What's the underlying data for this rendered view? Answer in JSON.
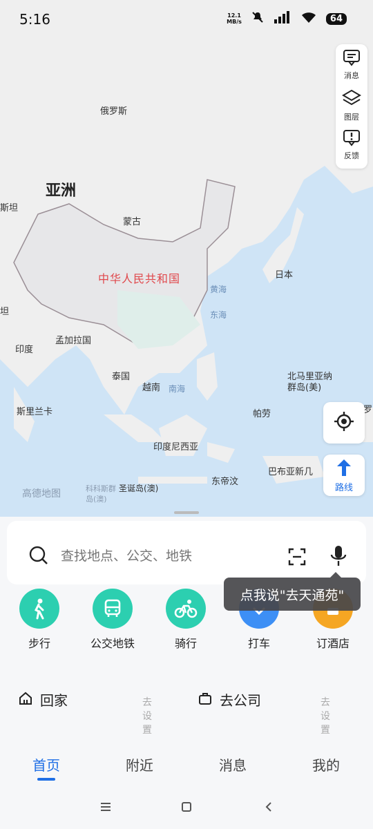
{
  "status_bar": {
    "time": "5:16",
    "net_speed_top": "12.1",
    "net_speed_bottom": "MB/s",
    "battery": "64"
  },
  "map": {
    "labels": {
      "russia": "俄罗斯",
      "asia": "亚洲",
      "mongolia": "蒙古",
      "china": "中华人民共和国",
      "japan": "日本",
      "india": "印度",
      "bangladesh": "孟加拉国",
      "thailand": "泰国",
      "vietnam": "越南",
      "sri_lanka": "斯里兰卡",
      "indonesia": "印度尼西亚",
      "philippines": "帕劳",
      "east_timor": "东帝汶",
      "papua": "巴布亚新几",
      "mariana": "北马里亚纳",
      "mariana2": "群岛(美)",
      "left_1": "斯坦",
      "left_2": "坦",
      "yellow_sea": "黄海",
      "east_sea": "东海",
      "south_sea": "南海",
      "christmas": "圣诞岛(澳)",
      "cocos1": "科科斯群",
      "cocos2": "岛(澳)",
      "right_edge": "罗"
    },
    "credit": "高德地图"
  },
  "map_tools": [
    {
      "icon": "message-icon",
      "label": "消息"
    },
    {
      "icon": "layers-icon",
      "label": "图层"
    },
    {
      "icon": "feedback-icon",
      "label": "反馈"
    }
  ],
  "route_button": {
    "label": "路线"
  },
  "search": {
    "placeholder": "查找地点、公交、地铁"
  },
  "voice_tip": "点我说\"去天通苑\"",
  "modes": [
    {
      "label": "步行",
      "icon": "walk-icon",
      "color": "#2ccfb0"
    },
    {
      "label": "公交地铁",
      "icon": "bus-icon",
      "color": "#2ccfb0"
    },
    {
      "label": "骑行",
      "icon": "bike-icon",
      "color": "#2ccfb0"
    },
    {
      "label": "打车",
      "icon": "taxi-icon",
      "color": "#3d8ff5"
    },
    {
      "label": "订酒店",
      "icon": "hotel-icon",
      "color": "#f5a623"
    }
  ],
  "favorites": {
    "home": {
      "label": "回家",
      "hint": "去设置"
    },
    "work": {
      "label": "去公司",
      "hint": "去设置"
    }
  },
  "tabs": [
    {
      "label": "首页",
      "active": true
    },
    {
      "label": "附近",
      "active": false
    },
    {
      "label": "消息",
      "active": false
    },
    {
      "label": "我的",
      "active": false
    }
  ]
}
